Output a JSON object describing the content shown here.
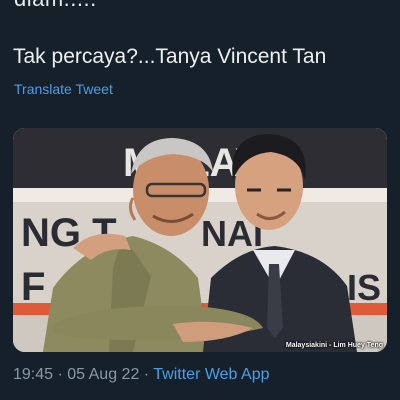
{
  "tweet": {
    "cut_text": "diam.....",
    "text": "Tak percaya?...Tanya Vincent Tan",
    "translate_label": "Translate Tweet",
    "media": {
      "banner_top": "MALAYSI",
      "banner_mid": "NG T",
      "banner_mid2": "NAI",
      "banner_low": "F",
      "banner_low2": "IS",
      "credit": "Malaysiakini - Lim Huey Teng"
    },
    "time": "19:45",
    "separator1": " · ",
    "date": "05 Aug 22",
    "separator2": " · ",
    "source": "Twitter Web App"
  },
  "colors": {
    "background": "#15202b",
    "text": "#e7e9ea",
    "link": "#4a9fe8",
    "muted": "#8b98a5"
  }
}
